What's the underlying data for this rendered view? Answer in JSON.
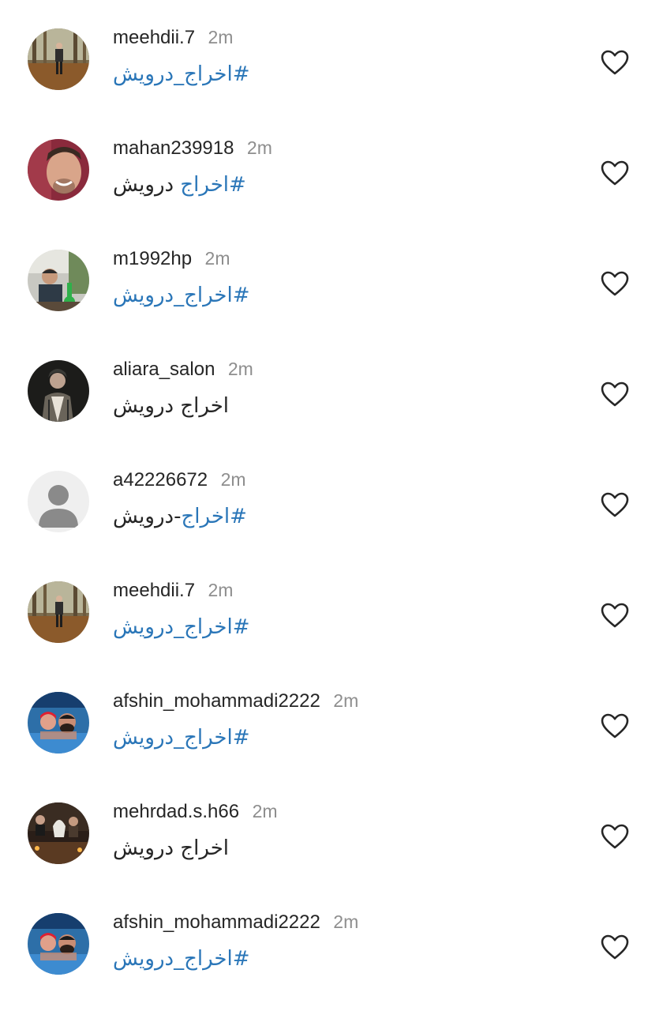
{
  "comments": [
    {
      "username": "meehdii.7",
      "time": "2m",
      "text_hashtag": "#اخراج_درویش",
      "text_plain": "",
      "avatar": "forest-man"
    },
    {
      "username": "mahan239918",
      "time": "2m",
      "text_hashtag": "#اخراج",
      "text_plain": " درویش",
      "avatar": "smiling-man"
    },
    {
      "username": "m1992hp",
      "time": "2m",
      "text_hashtag": "#اخراج_درویش",
      "text_plain": "",
      "avatar": "man-hookah"
    },
    {
      "username": "aliara_salon",
      "time": "2m",
      "text_hashtag": "",
      "text_plain": "اخراج درویش",
      "avatar": "dark-portrait"
    },
    {
      "username": "a42226672",
      "time": "2m",
      "text_hashtag": "#اخراج",
      "text_plain": "-درویش",
      "avatar": "default-person"
    },
    {
      "username": "meehdii.7",
      "time": "2m",
      "text_hashtag": "#اخراج_درویش",
      "text_plain": "",
      "avatar": "forest-man"
    },
    {
      "username": "afshin_mohammadi2222",
      "time": "2m",
      "text_hashtag": "#اخراج_درویش",
      "text_plain": "",
      "avatar": "pool-selfie"
    },
    {
      "username": "mehrdad.s.h66",
      "time": "2m",
      "text_hashtag": "",
      "text_plain": "اخراج درویش",
      "avatar": "lamp-room"
    },
    {
      "username": "afshin_mohammadi2222",
      "time": "2m",
      "text_hashtag": "#اخراج_درویش",
      "text_plain": "",
      "avatar": "pool-selfie"
    }
  ],
  "colors": {
    "hashtag": "#2a76b8",
    "username": "#262626",
    "timestamp": "#8e8e8e",
    "heart_outline": "#262626"
  },
  "icons": {
    "like": "heart-outline-icon"
  }
}
